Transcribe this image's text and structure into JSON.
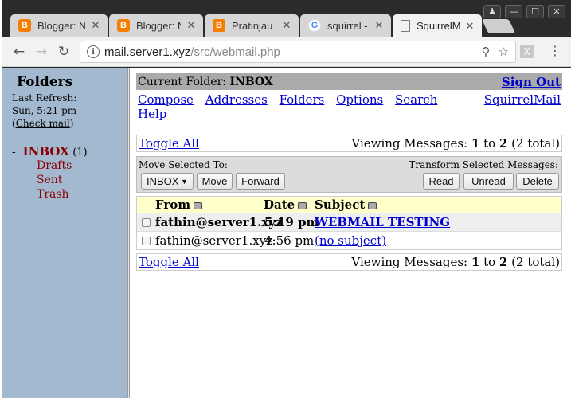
{
  "browser": {
    "tabs": [
      {
        "label": "Blogger: N",
        "icon": "blogger-icon"
      },
      {
        "label": "Blogger: N",
        "icon": "blogger-icon"
      },
      {
        "label": "Pratinjau '",
        "icon": "blogger-icon"
      },
      {
        "label": "squirrel - C",
        "icon": "google-icon"
      },
      {
        "label": "SquirrelM",
        "icon": "page-icon"
      }
    ],
    "url_host": "mail.server1.xyz",
    "url_path": "/src/webmail.php",
    "extension_label": "X"
  },
  "sidebar": {
    "title": "Folders",
    "last_refresh_label": "Last Refresh:",
    "last_refresh_time": "Sun, 5:21 pm",
    "check_mail_open": "(",
    "check_mail": "Check mail",
    "check_mail_close": ")",
    "folders": {
      "inbox_dash": "-",
      "inbox": "INBOX",
      "inbox_count": "(1)",
      "drafts": "Drafts",
      "sent": "Sent",
      "trash": "Trash"
    }
  },
  "header": {
    "current_folder_label": "Current Folder:",
    "current_folder": "INBOX",
    "sign_out": "Sign Out"
  },
  "nav": {
    "compose": "Compose",
    "addresses": "Addresses",
    "folders": "Folders",
    "options": "Options",
    "search": "Search",
    "help": "Help",
    "squirrelmail": "SquirrelMail"
  },
  "paging": {
    "toggle_all": "Toggle All",
    "viewing_prefix": "Viewing Messages:",
    "from": "1",
    "to_word": "to",
    "to": "2",
    "total": "(2 total)"
  },
  "actions": {
    "move_label": "Move Selected To:",
    "transform_label": "Transform Selected Messages:",
    "move_target": "INBOX",
    "move": "Move",
    "forward": "Forward",
    "read": "Read",
    "unread": "Unread",
    "delete": "Delete"
  },
  "messages": {
    "columns": {
      "from": "From",
      "date": "Date",
      "subject": "Subject"
    },
    "rows": [
      {
        "from": "fathin@server1.xyz",
        "date": "5:19 pm",
        "subject": "WEBMAIL TESTING",
        "unread": true
      },
      {
        "from": "fathin@server1.xyz",
        "date": "4:56 pm",
        "subject": "(no subject)",
        "unread": false
      }
    ]
  }
}
